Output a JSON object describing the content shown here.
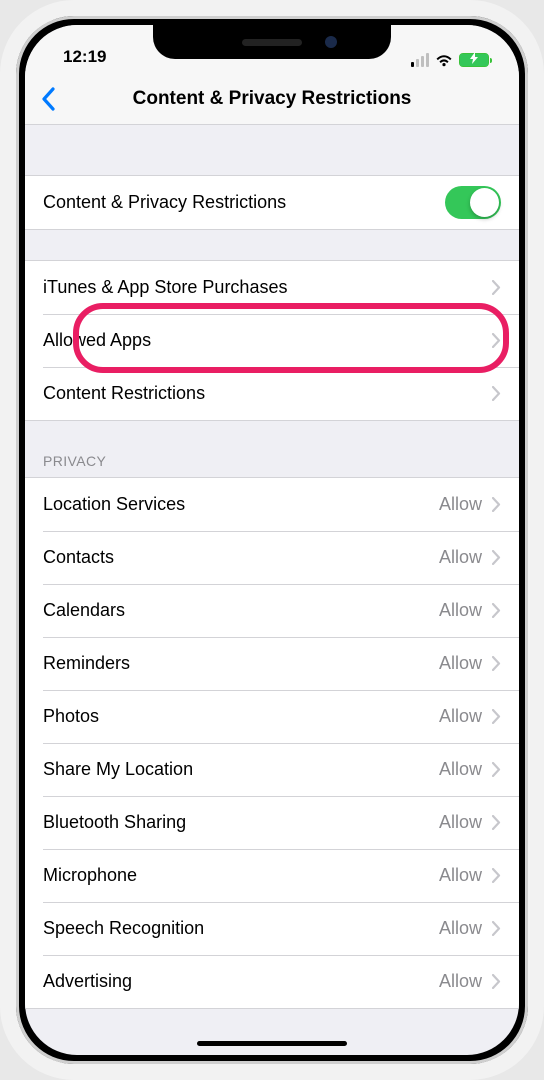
{
  "status": {
    "time": "12:19"
  },
  "nav": {
    "title": "Content & Privacy Restrictions"
  },
  "toggle_row": {
    "label": "Content & Privacy Restrictions",
    "on": true
  },
  "section2": {
    "rows": [
      {
        "label": "iTunes & App Store Purchases",
        "highlighted": true
      },
      {
        "label": "Allowed Apps"
      },
      {
        "label": "Content Restrictions"
      }
    ]
  },
  "privacy": {
    "header": "PRIVACY",
    "allow": "Allow",
    "rows": [
      {
        "label": "Location Services"
      },
      {
        "label": "Contacts"
      },
      {
        "label": "Calendars"
      },
      {
        "label": "Reminders"
      },
      {
        "label": "Photos"
      },
      {
        "label": "Share My Location"
      },
      {
        "label": "Bluetooth Sharing"
      },
      {
        "label": "Microphone"
      },
      {
        "label": "Speech Recognition"
      },
      {
        "label": "Advertising"
      }
    ]
  }
}
